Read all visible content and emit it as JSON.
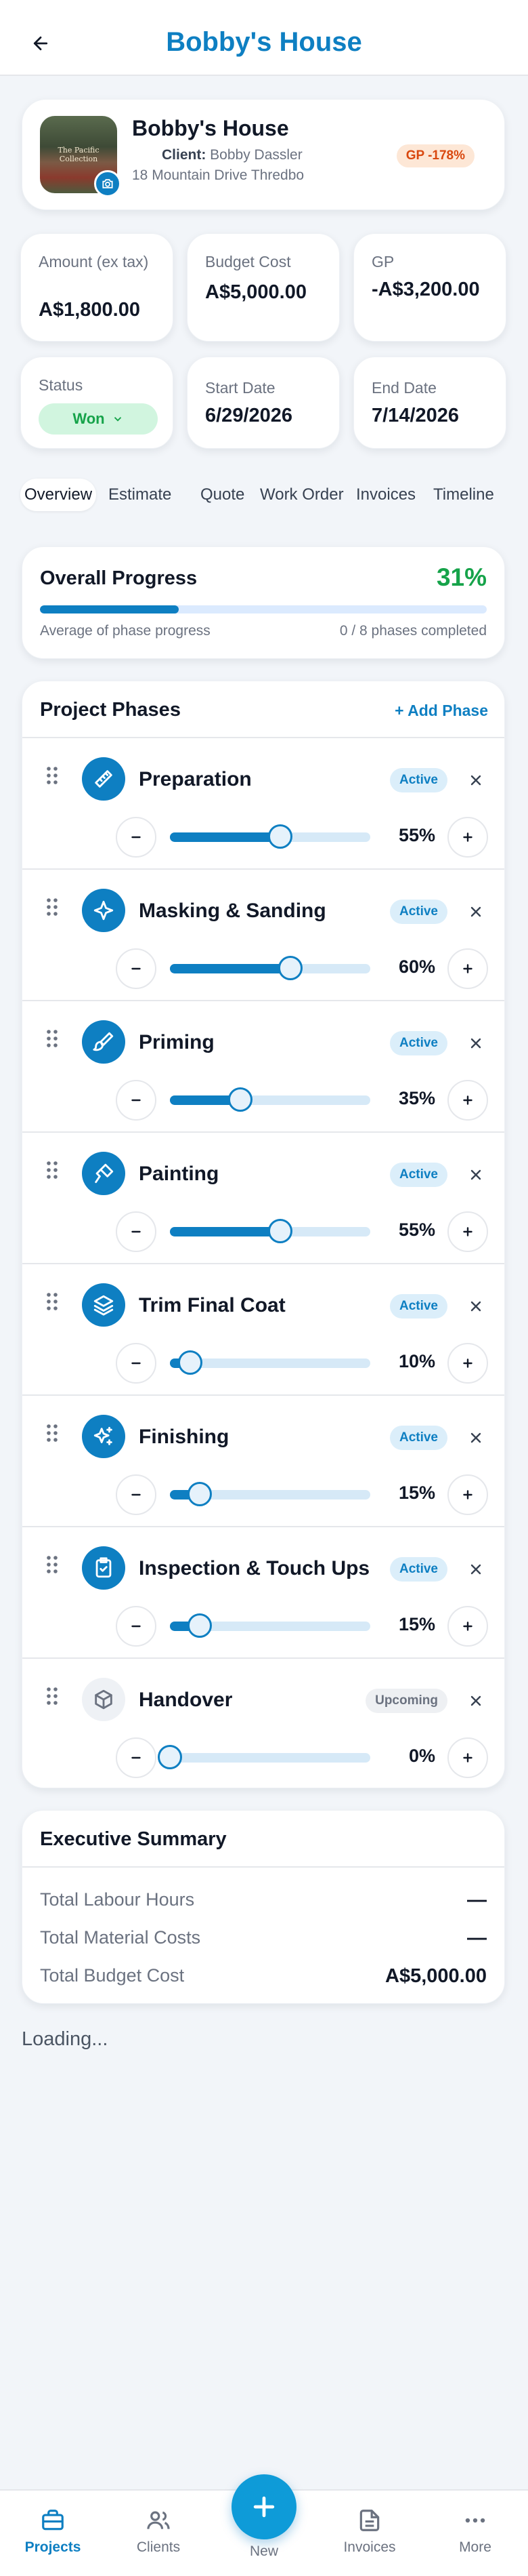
{
  "header": {
    "title": "Bobby's House",
    "back_icon": "arrow-left-icon"
  },
  "project": {
    "name": "Bobby's House",
    "client_label": "Client:",
    "client_name": "Bobby Dassler",
    "address": "18 Mountain Drive Thredbo",
    "gp_badge": "GP -178%",
    "thumbnail_text": "The Pacific Collection"
  },
  "stats": {
    "amount_label": "Amount (ex tax)",
    "amount_value": "A$1,800.00",
    "budget_label": "Budget Cost",
    "budget_value": "A$5,000.00",
    "gp_label": "GP",
    "gp_value": "-A$3,200.00",
    "status_label": "Status",
    "status_value": "Won",
    "start_label": "Start Date",
    "start_value": "6/29/2026",
    "end_label": "End Date",
    "end_value": "7/14/2026"
  },
  "tabs": [
    "Overview",
    "Estimate",
    "Quote",
    "Work Order",
    "Invoices",
    "Timeline"
  ],
  "progress": {
    "title": "Overall Progress",
    "percent": "31%",
    "fraction": 0.31,
    "sub_left": "Average of phase progress",
    "sub_right": "0 / 8 phases completed"
  },
  "phases_section": {
    "title": "Project Phases",
    "add_label": "+ Add Phase"
  },
  "phases": [
    {
      "name": "Preparation",
      "status": "Active",
      "percent_label": "55%",
      "value": 0.55,
      "icon": "ruler-icon"
    },
    {
      "name": "Masking & Sanding",
      "status": "Active",
      "percent_label": "60%",
      "value": 0.6,
      "icon": "sparkle-icon"
    },
    {
      "name": "Priming",
      "status": "Active",
      "percent_label": "35%",
      "value": 0.35,
      "icon": "brush-icon"
    },
    {
      "name": "Painting",
      "status": "Active",
      "percent_label": "55%",
      "value": 0.55,
      "icon": "paint-brush-icon"
    },
    {
      "name": "Trim Final Coat",
      "status": "Active",
      "percent_label": "10%",
      "value": 0.1,
      "icon": "layers-icon"
    },
    {
      "name": "Finishing",
      "status": "Active",
      "percent_label": "15%",
      "value": 0.15,
      "icon": "sparkles-icon"
    },
    {
      "name": "Inspection & Touch Ups",
      "status": "Active",
      "percent_label": "15%",
      "value": 0.15,
      "icon": "clipboard-check-icon"
    },
    {
      "name": "Handover",
      "status": "Upcoming",
      "percent_label": "0%",
      "value": 0.0,
      "icon": "box-icon"
    }
  ],
  "summary": {
    "title": "Executive Summary",
    "rows": [
      {
        "label": "Total Labour Hours",
        "value": "—"
      },
      {
        "label": "Total Material Costs",
        "value": "—"
      },
      {
        "label": "Total Budget Cost",
        "value": "A$5,000.00"
      }
    ]
  },
  "loading_text": "Loading...",
  "nav": {
    "projects": "Projects",
    "clients": "Clients",
    "new": "New",
    "invoices": "Invoices",
    "more": "More"
  },
  "colors": {
    "accent": "#0e7fc2",
    "success": "#16a34a",
    "warning": "#d9480f"
  }
}
